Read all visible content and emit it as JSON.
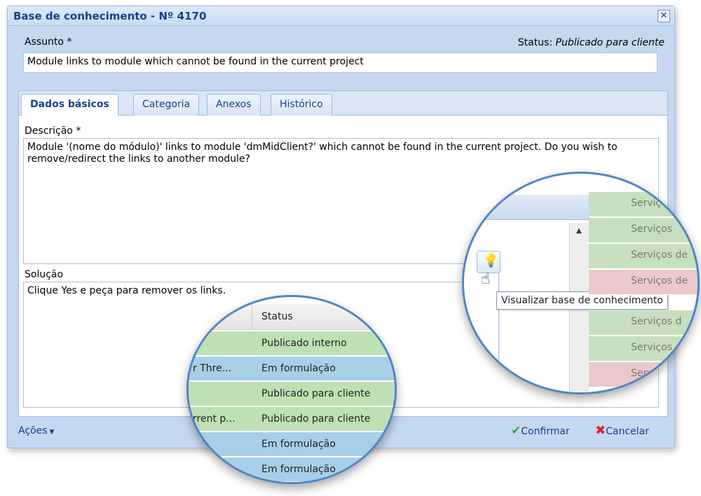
{
  "window": {
    "title": "Base de conhecimento - Nº 4170",
    "close_icon": "close-icon"
  },
  "subject": {
    "label": "Assunto *",
    "value": "Module links to module which cannot be found in the current project"
  },
  "status": {
    "label": "Status:",
    "value": "Publicado para cliente"
  },
  "tabs": [
    {
      "label": "Dados básicos"
    },
    {
      "label": "Categoria"
    },
    {
      "label": "Anexos"
    },
    {
      "label": "Histórico"
    }
  ],
  "description": {
    "label": "Descrição *",
    "value": "Module '(nome do módulo)' links to module 'dmMidClient?' which cannot be found in the current project. Do you wish to remove/redirect the links to another module?"
  },
  "solution": {
    "label": "Solução",
    "value": "Clique Yes e peça para remover os links."
  },
  "footer": {
    "actions_label": "Ações",
    "confirm_label": "Confirmar",
    "cancel_label": "Cancelar"
  },
  "zoom_left": {
    "column_header": "Status",
    "rows": [
      {
        "name": "",
        "status": "Publicado interno",
        "color": "green"
      },
      {
        "name": "r Thre...",
        "status": "Em formulação",
        "color": "blue"
      },
      {
        "name": "",
        "status": "Publicado para cliente",
        "color": "green"
      },
      {
        "name": "rrent p...",
        "status": "Publicado para cliente",
        "color": "green"
      },
      {
        "name": "",
        "status": "Em formulação",
        "color": "blue"
      },
      {
        "name": "",
        "status": "Em formulação",
        "color": "blue"
      }
    ]
  },
  "zoom_right": {
    "tooltip": "Visualizar base de conhecimento",
    "button_icon": "lightbulb-icon",
    "rows": [
      {
        "text": "Serviç",
        "color": "green"
      },
      {
        "text": "Serviços",
        "color": "green"
      },
      {
        "text": "Serviços de",
        "color": "green"
      },
      {
        "text": "Serviços de",
        "color": "pink"
      },
      {
        "text": "Serviços d",
        "color": "green"
      },
      {
        "text": "Serviços",
        "color": "green"
      },
      {
        "text": "Servi",
        "color": "pink"
      }
    ]
  },
  "colors": {
    "title": "#15428b",
    "row_green": "#bfe0b5",
    "row_blue": "#a8cfe8",
    "row_pink": "#ebc9c9",
    "confirm": "#3aa23a",
    "cancel": "#d8262d"
  }
}
